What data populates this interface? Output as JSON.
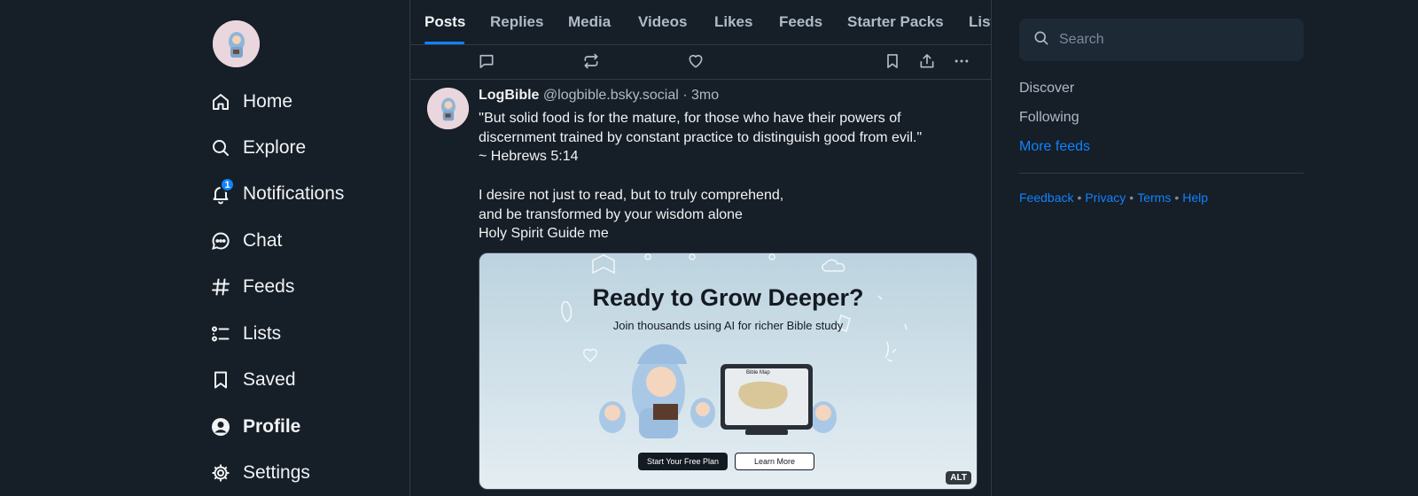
{
  "nav": {
    "items": [
      {
        "label": "Home",
        "icon": "home-icon"
      },
      {
        "label": "Explore",
        "icon": "search-icon"
      },
      {
        "label": "Notifications",
        "icon": "bell-icon",
        "badge": "1"
      },
      {
        "label": "Chat",
        "icon": "chat-icon"
      },
      {
        "label": "Feeds",
        "icon": "hash-icon"
      },
      {
        "label": "Lists",
        "icon": "list-icon"
      },
      {
        "label": "Saved",
        "icon": "bookmark-icon"
      },
      {
        "label": "Profile",
        "icon": "profile-icon",
        "active": true
      },
      {
        "label": "Settings",
        "icon": "gear-icon"
      }
    ]
  },
  "tabs": [
    {
      "label": "Posts",
      "active": true
    },
    {
      "label": "Replies"
    },
    {
      "label": "Media"
    },
    {
      "label": "Videos"
    },
    {
      "label": "Likes"
    },
    {
      "label": "Feeds"
    },
    {
      "label": "Starter Packs"
    },
    {
      "label": "List"
    }
  ],
  "post": {
    "author": "LogBible",
    "handle": "@logbible.bsky.social",
    "time": "· 3mo",
    "lines": [
      "''But solid food is for the mature, for those who have their powers of",
      "discernment trained by constant practice to distinguish good from evil.\"",
      "~ Hebrews 5:14",
      "",
      "I desire not just to read, but to truly comprehend,",
      "and be transformed by your wisdom alone",
      "Holy Spirit Guide me"
    ],
    "image": {
      "title": "Ready to Grow Deeper?",
      "subtitle": "Join thousands using AI for richer Bible study",
      "tablet_label": "Bible Map",
      "button_primary": "Start Your Free Plan",
      "button_secondary": "Learn More",
      "alt_badge": "ALT"
    }
  },
  "right": {
    "search_placeholder": "Search",
    "feeds": [
      "Discover",
      "Following"
    ],
    "more_feeds": "More feeds",
    "footer": [
      "Feedback",
      "Privacy",
      "Terms",
      "Help"
    ]
  },
  "colors": {
    "background": "#161e27",
    "accent": "#1083fe",
    "muted_text": "#aebbc9"
  }
}
